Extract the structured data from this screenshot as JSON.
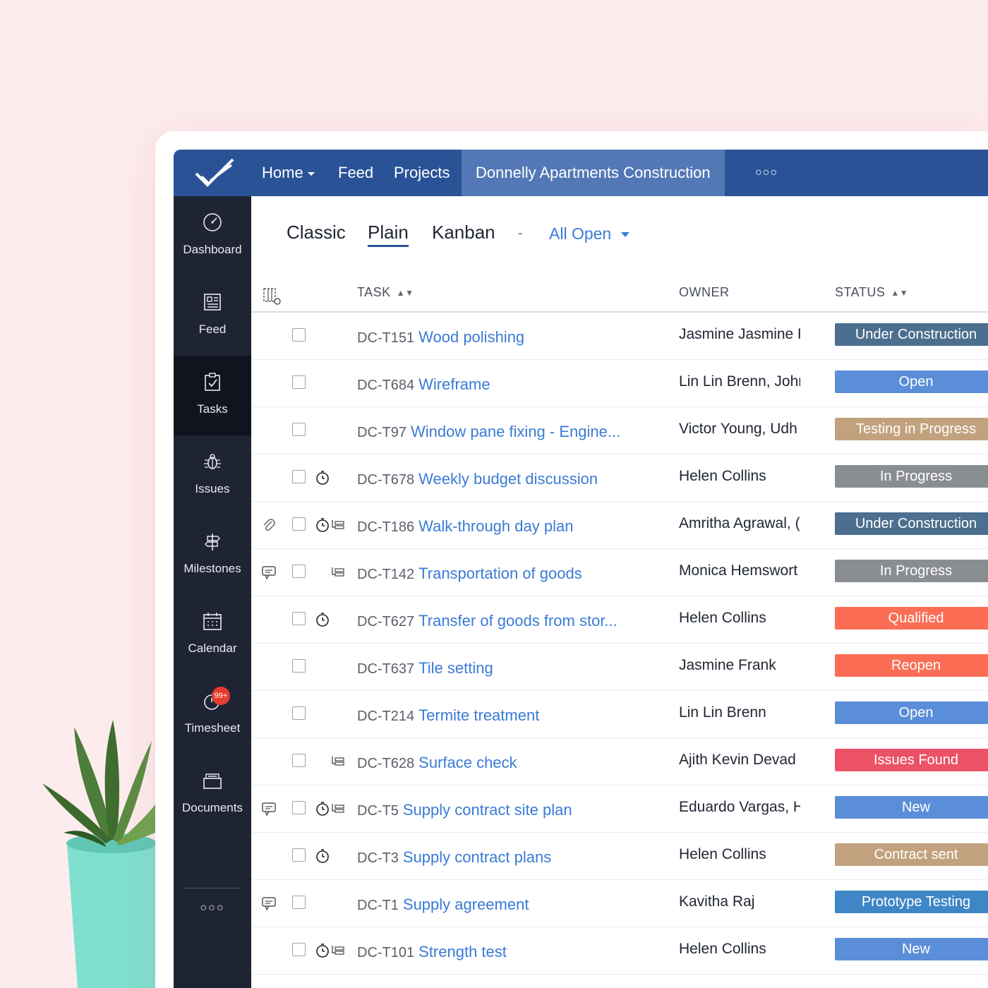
{
  "topbar": {
    "home": "Home",
    "feed": "Feed",
    "projects": "Projects",
    "current_project": "Donnelly Apartments Construction",
    "more": "○○○"
  },
  "sidebar": {
    "items": [
      {
        "label": "Dashboard",
        "icon": "speedometer-icon"
      },
      {
        "label": "Feed",
        "icon": "newspaper-icon"
      },
      {
        "label": "Tasks",
        "icon": "clipboard-check-icon"
      },
      {
        "label": "Issues",
        "icon": "bug-icon"
      },
      {
        "label": "Milestones",
        "icon": "signpost-icon"
      },
      {
        "label": "Calendar",
        "icon": "calendar-icon"
      },
      {
        "label": "Timesheet",
        "icon": "timer-icon",
        "badge": "99+"
      },
      {
        "label": "Documents",
        "icon": "folder-icon"
      }
    ],
    "more": "○○○"
  },
  "views": {
    "classic": "Classic",
    "plain": "Plain",
    "kanban": "Kanban",
    "separator": "-",
    "filter": "All Open"
  },
  "table": {
    "headers": {
      "task": "TASK",
      "owner": "OWNER",
      "status": "STATUS"
    },
    "rows": [
      {
        "id": "DC-T151",
        "name": "Wood polishing",
        "owner": "Jasmine Jasmine F",
        "status": "Under Construction",
        "color": "#4c6e8f",
        "attach": false,
        "comment": false,
        "timer": false,
        "sub": false
      },
      {
        "id": "DC-T684",
        "name": "Wireframe",
        "owner": "Lin Lin Brenn, Johr",
        "status": "Open",
        "color": "#5b8ed8",
        "attach": false,
        "comment": false,
        "timer": false,
        "sub": false
      },
      {
        "id": "DC-T97",
        "name": "Window pane fixing - Engine...",
        "owner": "Victor Young, Udh",
        "status": "Testing in Progress",
        "color": "#c2a27e",
        "attach": false,
        "comment": false,
        "timer": false,
        "sub": false
      },
      {
        "id": "DC-T678",
        "name": "Weekly budget discussion",
        "owner": "Helen Collins",
        "status": "In Progress",
        "color": "#8a8d92",
        "attach": false,
        "comment": false,
        "timer": true,
        "sub": false
      },
      {
        "id": "DC-T186",
        "name": "Walk-through day plan",
        "owner": "Amritha Agrawal, (",
        "status": "Under Construction",
        "color": "#4c6e8f",
        "attach": true,
        "comment": false,
        "timer": true,
        "sub": true
      },
      {
        "id": "DC-T142",
        "name": "Transportation of goods",
        "owner": "Monica Hemswort",
        "status": "In Progress",
        "color": "#8a8d92",
        "attach": false,
        "comment": true,
        "timer": false,
        "sub": true
      },
      {
        "id": "DC-T627",
        "name": "Transfer of goods from stor...",
        "owner": "Helen Collins",
        "status": "Qualified",
        "color": "#fb6e55",
        "attach": false,
        "comment": false,
        "timer": true,
        "sub": false
      },
      {
        "id": "DC-T637",
        "name": "Tile setting",
        "owner": "Jasmine Frank",
        "status": "Reopen",
        "color": "#fb6e55",
        "attach": false,
        "comment": false,
        "timer": false,
        "sub": false
      },
      {
        "id": "DC-T214",
        "name": "Termite treatment",
        "owner": "Lin Lin Brenn",
        "status": "Open",
        "color": "#5b8ed8",
        "attach": false,
        "comment": false,
        "timer": false,
        "sub": false
      },
      {
        "id": "DC-T628",
        "name": "Surface check",
        "owner": "Ajith Kevin Devad",
        "status": "Issues Found",
        "color": "#ec5266",
        "attach": false,
        "comment": false,
        "timer": false,
        "sub": true
      },
      {
        "id": "DC-T5",
        "name": "Supply contract site plan",
        "owner": "Eduardo Vargas, H",
        "status": "New",
        "color": "#5b8ed8",
        "attach": false,
        "comment": true,
        "timer": true,
        "sub": true
      },
      {
        "id": "DC-T3",
        "name": "Supply contract plans",
        "owner": "Helen Collins",
        "status": "Contract sent",
        "color": "#c2a27e",
        "attach": false,
        "comment": false,
        "timer": true,
        "sub": false
      },
      {
        "id": "DC-T1",
        "name": "Supply agreement",
        "owner": "Kavitha Raj",
        "status": "Prototype Testing",
        "color": "#3f86c6",
        "attach": false,
        "comment": true,
        "timer": false,
        "sub": false
      },
      {
        "id": "DC-T101",
        "name": "Strength test",
        "owner": "Helen Collins",
        "status": "New",
        "color": "#5b8ed8",
        "attach": false,
        "comment": false,
        "timer": true,
        "sub": true
      }
    ]
  }
}
